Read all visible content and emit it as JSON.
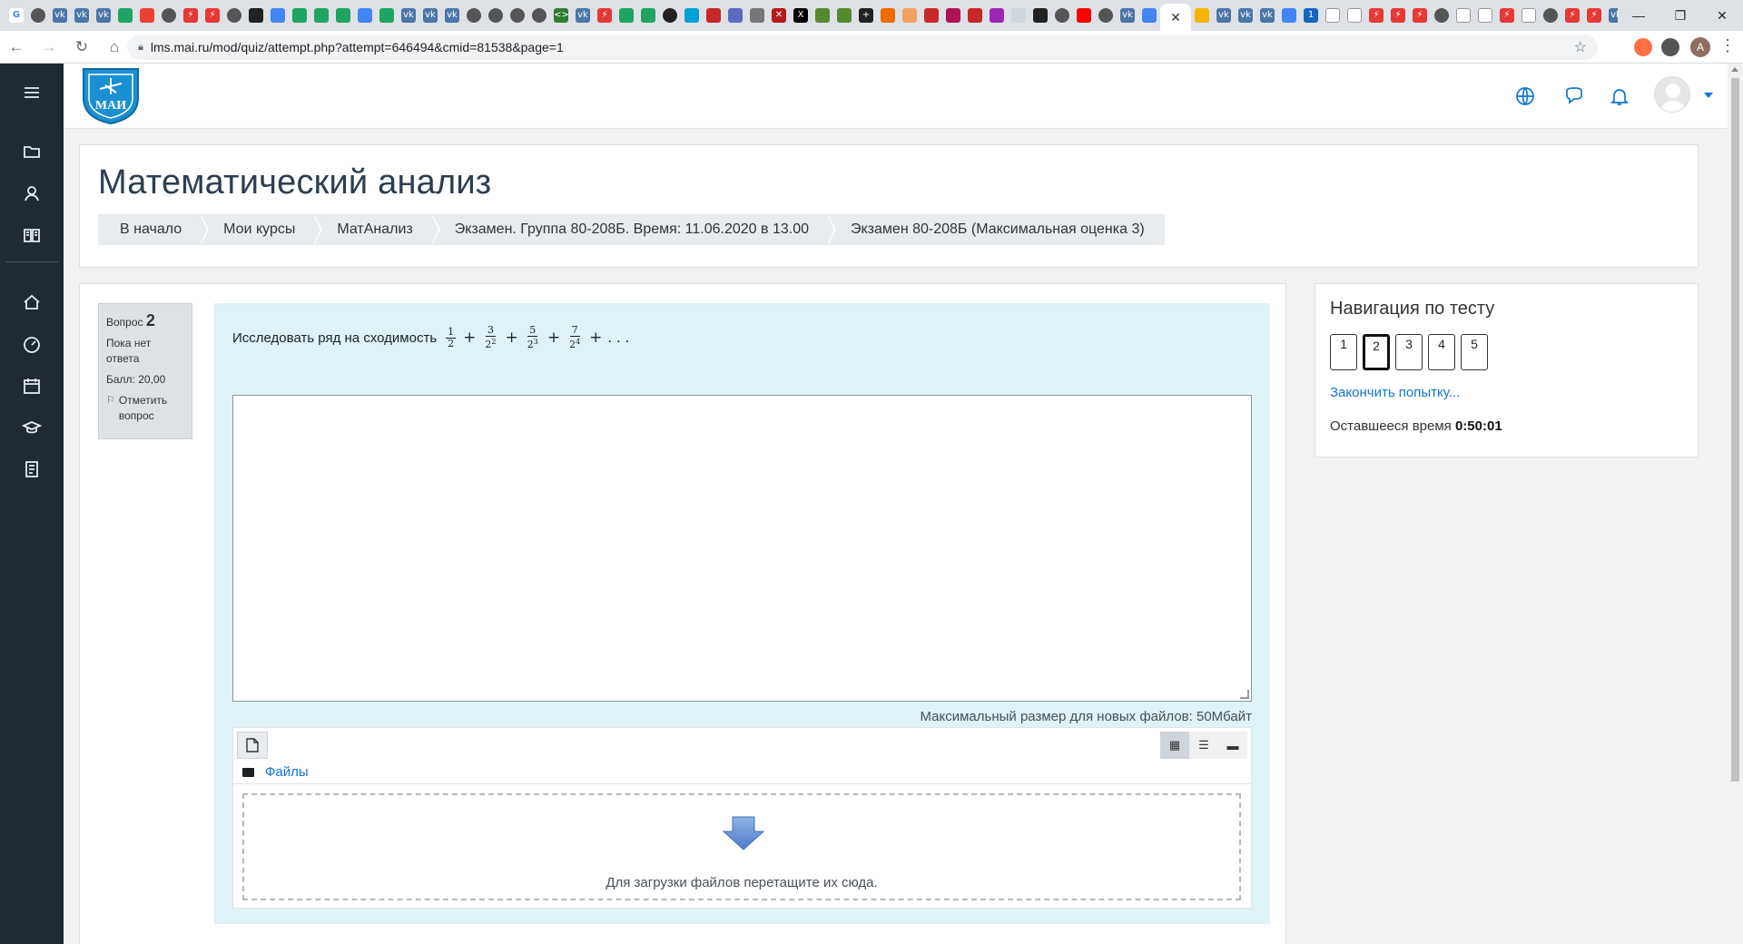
{
  "browser": {
    "url": "lms.mai.ru/mod/quiz/attempt.php?attempt=646494&cmid=81538&page=1",
    "profile_initial": "A",
    "active_tab_close": "✕",
    "new_tab": "+"
  },
  "site": {
    "logo_text": "МАИ"
  },
  "header": {
    "course_title": "Математический анализ",
    "breadcrumbs": [
      "В начало",
      "Мои курсы",
      "МатАнализ",
      "Экзамен. Группа 80-208Б. Время: 11.06.2020 в 13.00",
      "Экзамен 80-208Б (Максимальная оценка 3)"
    ]
  },
  "question": {
    "label": "Вопрос",
    "number": "2",
    "status": "Пока нет ответа",
    "score": "Балл: 20,00",
    "flag_label": "Отметить вопрос",
    "text": "Исследовать ряд на сходимость",
    "max_size": "Максимальный размер для новых файлов: 50Мбайт",
    "files_label": "Файлы",
    "drop_text": "Для загрузки файлов перетащите их сюда."
  },
  "quiz_nav": {
    "title": "Навигация по тесту",
    "questions": [
      "1",
      "2",
      "3",
      "4",
      "5"
    ],
    "current": "2",
    "finish_link": "Закончить попытку...",
    "time_label": "Оставшееся время",
    "time_value": "0:50:01"
  },
  "colors": {
    "accent": "#1177d1",
    "sidebar": "#1f2a33",
    "question_bg": "#def2f8"
  }
}
